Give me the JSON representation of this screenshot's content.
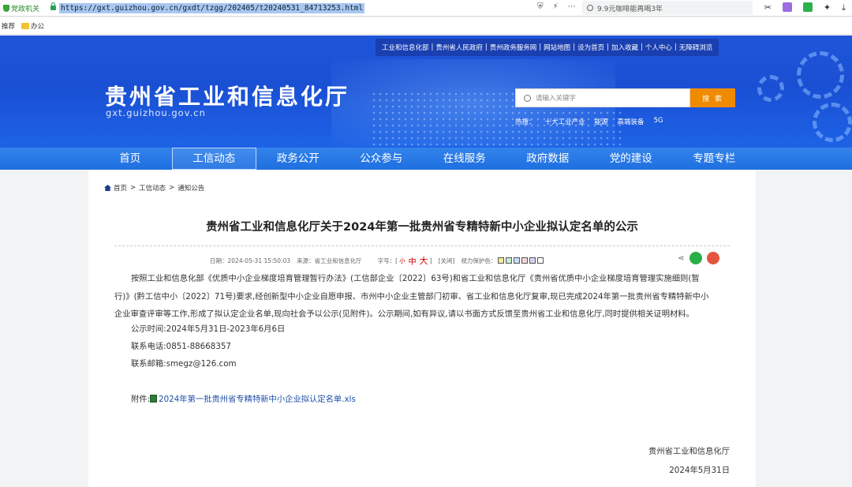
{
  "browser": {
    "gov_tag": "党政机关",
    "url": "https://gxt.guizhou.gov.cn/gxdt/tzgg/202405/t20240531_84713253.html",
    "search_text": "9.9元咖啡能再喝3年",
    "bookmarks": [
      {
        "label": "推荐"
      },
      {
        "label": "办公"
      }
    ]
  },
  "header": {
    "top_links": [
      "工业和信息化部",
      "贵州省人民政府",
      "贵州政务服务网",
      "网站地图",
      "设为首页",
      "加入收藏",
      "个人中心",
      "无障碍浏览"
    ],
    "site_title": "贵州省工业和信息化厅",
    "site_domain": "gxt.guizhou.gov.cn",
    "search_placeholder": "请输入关键字",
    "search_button": "搜 索",
    "hot_label": "热搜：",
    "hot_terms": [
      "十大工业产业",
      "能源",
      "高端装备",
      "5G"
    ]
  },
  "nav": {
    "items": [
      "首页",
      "工信动态",
      "政务公开",
      "公众参与",
      "在线服务",
      "政府数据",
      "党的建设",
      "专题专栏"
    ],
    "active_index": 1
  },
  "breadcrumb": [
    "首页",
    "工信动态",
    "通知公告"
  ],
  "article": {
    "title": "贵州省工业和信息化厅关于2024年第一批贵州省专精特新中小企业拟认定名单的公示",
    "date": "日期：2024-05-31 15:50:03",
    "source": "来源：省工业和信息化厅",
    "font_label": "字号：",
    "font_small": "小",
    "font_mid": "中",
    "font_large": "大",
    "close_label": "[关闭]",
    "eye_label": "视力保护色：",
    "body_lines": [
      "按照工业和信息化部《优质中小企业梯度培育管理暂行办法》(工信部企业〔2022〕63号)和省工业和信息化厅《贵州省优质中小企业梯度培育管理实施细则(暂",
      "行)》(黔工信中小〔2022〕71号)要求,经创新型中小企业自愿申报、市州中小企业主管部门初审、省工业和信息化厅复审,现已完成2024年第一批贵州省专精特新中小",
      "企业审查评审等工作,形成了拟认定企业名单,现向社会予以公示(见附件)。公示期间,如有异议,请以书面方式反馈至贵州省工业和信息化厅,同时提供相关证明材料。"
    ],
    "period": "公示时间:2024年5月31日-2023年6月6日",
    "phone": "联系电话:0851-88668357",
    "email": "联系邮箱:smegz@126.com",
    "attach_label": "附件:",
    "attach_file": "2024年第一批贵州省专精特新中小企业拟认定名单.xls",
    "signer": "贵州省工业和信息化厅",
    "sign_date": "2024年5月31日"
  }
}
